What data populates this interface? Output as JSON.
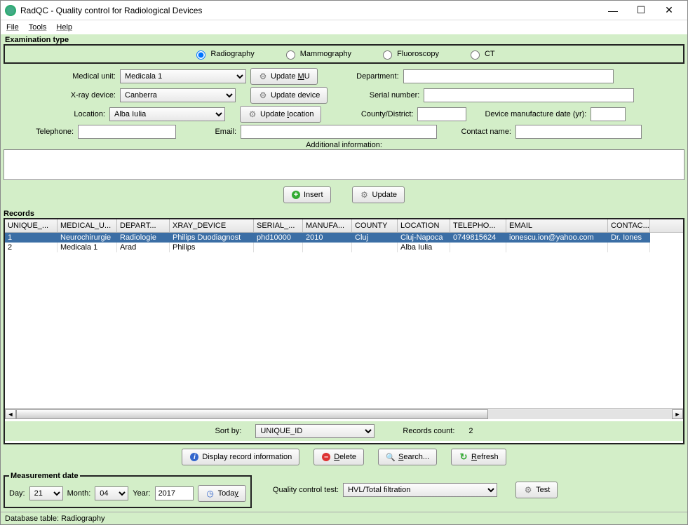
{
  "window": {
    "title": "RadQC - Quality control for Radiological Devices"
  },
  "menu": {
    "file": "File",
    "tools": "Tools",
    "help": "Help"
  },
  "exam": {
    "legend": "Examination type",
    "radiography": "Radiography",
    "mammography": "Mammography",
    "fluoroscopy": "Fluoroscopy",
    "ct": "CT",
    "selected": "radiography"
  },
  "form": {
    "medical_unit_label": "Medical unit:",
    "medical_unit_value": "Medicala 1",
    "update_mu": "Update MU",
    "department_label": "Department:",
    "department_value": "",
    "xray_label": "X-ray device:",
    "xray_value": "Canberra",
    "update_device": "Update device",
    "serial_label": "Serial number:",
    "serial_value": "",
    "location_label": "Location:",
    "location_value": "Alba Iulia",
    "update_location": "Update location",
    "county_label": "County/District:",
    "county_value": "",
    "mfd_label": "Device manufacture date (yr):",
    "mfd_value": "",
    "telephone_label": "Telephone:",
    "telephone_value": "",
    "email_label": "Email:",
    "email_value": "",
    "contact_label": "Contact name:",
    "contact_value": "",
    "addl_label": "Additional information:",
    "addl_value": "",
    "insert": "Insert",
    "update": "Update"
  },
  "records": {
    "legend": "Records",
    "columns": [
      "UNIQUE_...",
      "MEDICAL_U...",
      "DEPART...",
      "XRAY_DEVICE",
      "SERIAL_...",
      "MANUFA...",
      "COUNTY",
      "LOCATION",
      "TELEPHO...",
      "EMAIL",
      "CONTAC..."
    ],
    "rows": [
      {
        "selected": true,
        "cells": [
          "1",
          "Neurochirurgie",
          "Radiologie",
          "Philips Duodiagnost",
          "phd10000",
          "2010",
          "Cluj",
          "Cluj-Napoca",
          "0749815624",
          "ionescu.ion@yahoo.com",
          "Dr. Iones"
        ]
      },
      {
        "selected": false,
        "cells": [
          "2",
          "Medicala 1",
          "Arad",
          "Philips",
          "",
          "",
          "",
          "Alba Iulia",
          "",
          "",
          ""
        ]
      }
    ],
    "sort_by_label": "Sort by:",
    "sort_by_value": "UNIQUE_ID",
    "count_label": "Records count:",
    "count_value": "2"
  },
  "actions": {
    "display": "Display record information",
    "delete": "Delete",
    "search": "Search...",
    "refresh": "Refresh"
  },
  "measure": {
    "legend": "Measurement date",
    "day_label": "Day:",
    "day_value": "21",
    "month_label": "Month:",
    "month_value": "04",
    "year_label": "Year:",
    "year_value": "2017",
    "today": "Today"
  },
  "qc": {
    "label": "Quality control test:",
    "value": "HVL/Total filtration",
    "test": "Test"
  },
  "status": {
    "text": "Database table: Radiography"
  },
  "chart_data": {
    "type": "table",
    "columns": [
      "UNIQUE_ID",
      "MEDICAL_UNIT",
      "DEPARTMENT",
      "XRAY_DEVICE",
      "SERIAL_NUMBER",
      "MANUFACTURE_DATE",
      "COUNTY",
      "LOCATION",
      "TELEPHONE",
      "EMAIL",
      "CONTACT"
    ],
    "rows": [
      [
        "1",
        "Neurochirurgie",
        "Radiologie",
        "Philips Duodiagnost",
        "phd10000",
        "2010",
        "Cluj",
        "Cluj-Napoca",
        "0749815624",
        "ionescu.ion@yahoo.com",
        "Dr. Iones"
      ],
      [
        "2",
        "Medicala 1",
        "Arad",
        "Philips",
        "",
        "",
        "",
        "Alba Iulia",
        "",
        "",
        ""
      ]
    ]
  }
}
